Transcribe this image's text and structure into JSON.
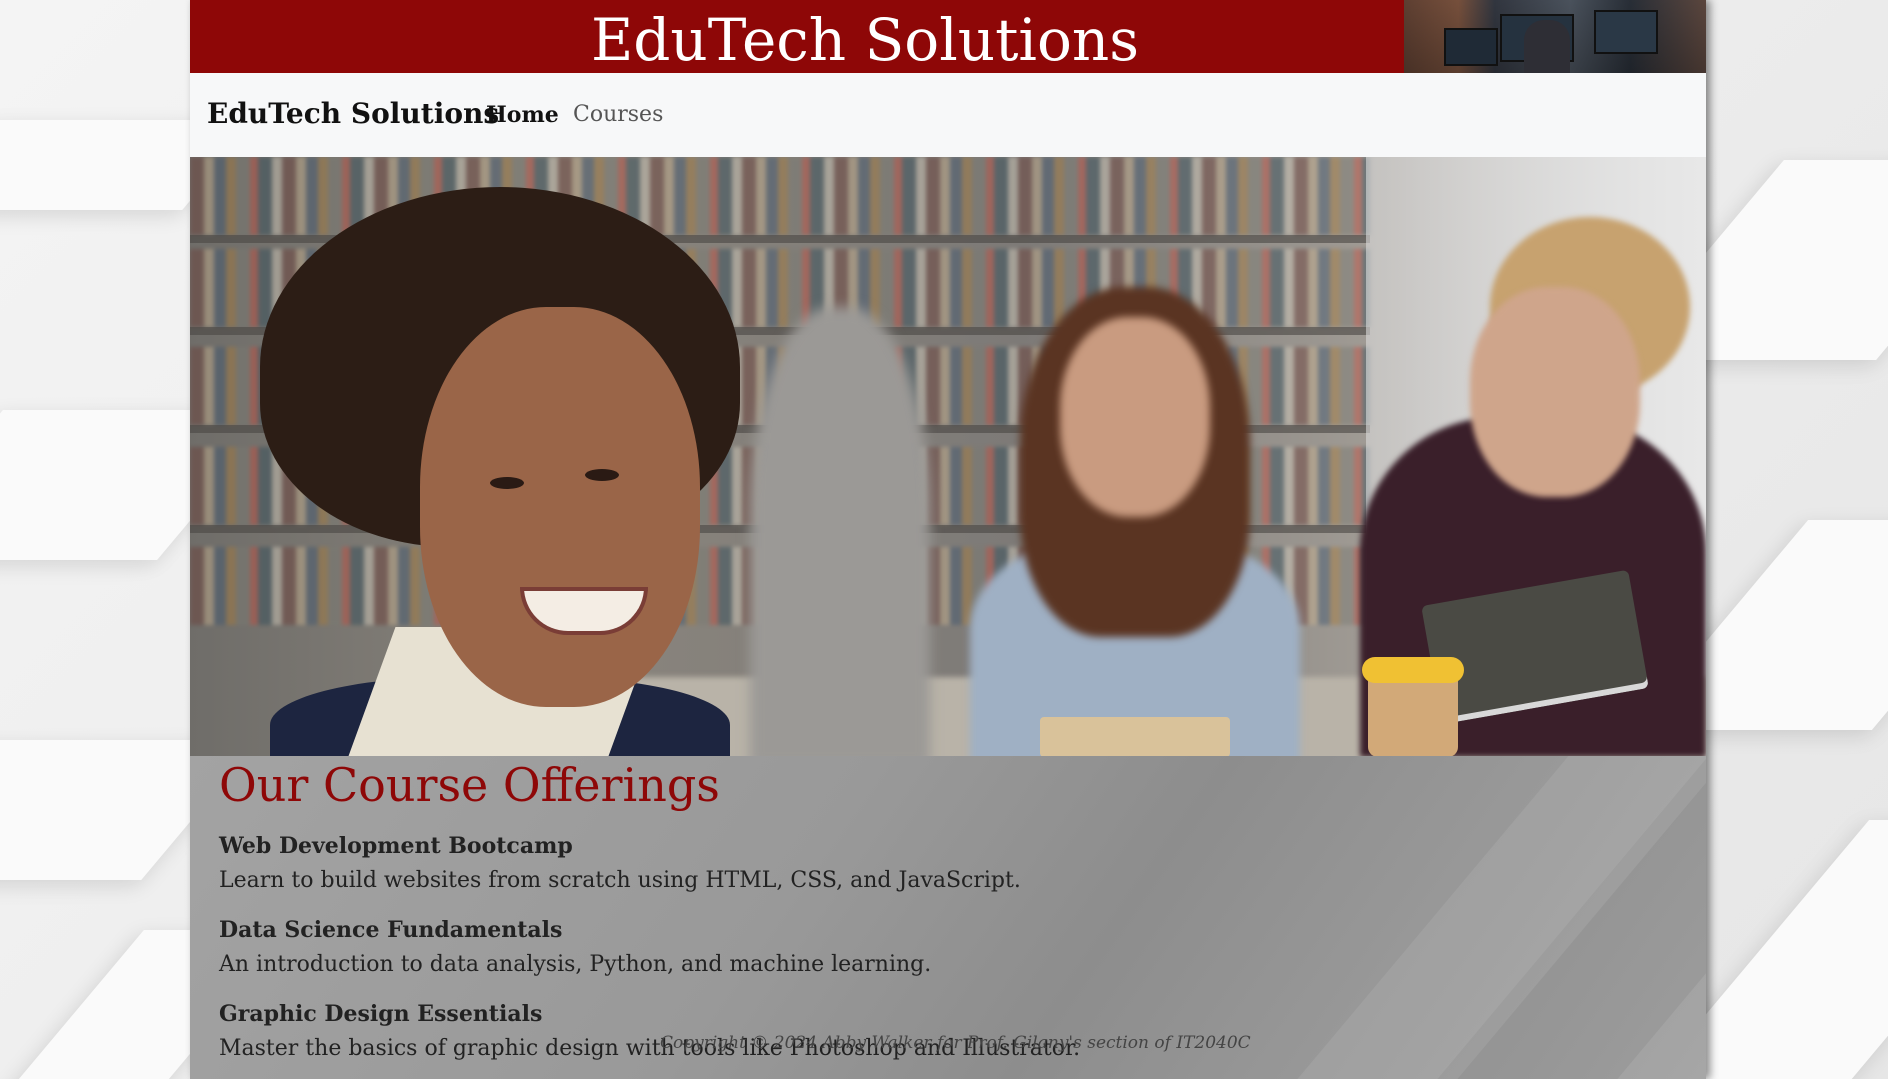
{
  "banner": {
    "title": "EduTech Solutions"
  },
  "nav": {
    "brand": "EduTech Solutions",
    "links": [
      {
        "label": "Home",
        "active": true
      },
      {
        "label": "Courses",
        "active": false
      }
    ]
  },
  "courses": {
    "title": "Our Course Offerings",
    "items": [
      {
        "name": "Web Development Bootcamp",
        "description": "Learn to build websites from scratch using HTML, CSS, and JavaScript."
      },
      {
        "name": "Data Science Fundamentals",
        "description": "An introduction to data analysis, Python, and machine learning."
      },
      {
        "name": "Graphic Design Essentials",
        "description": "Master the basics of graphic design with tools like Photoshop and Illustrator."
      }
    ]
  },
  "footer": {
    "copyright": "Copyright © 2024 Abby Walker for Prof. Gilany's section of IT2040C"
  },
  "colors": {
    "brand_red": "#8e0707",
    "nav_background": "#f7f8f9",
    "content_background": "#9a9a9a"
  }
}
